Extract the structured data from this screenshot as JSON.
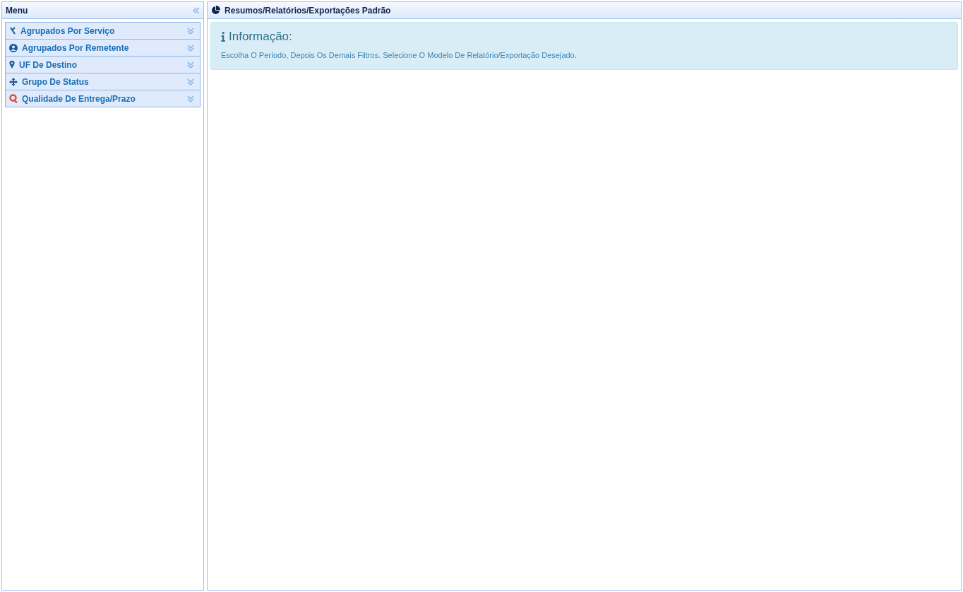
{
  "sidebar": {
    "title": "Menu",
    "items": [
      {
        "label": "Agrupados Por Serviço",
        "expanded": false
      },
      {
        "label": "Agrupados Por Remetente",
        "expanded": false
      },
      {
        "label": "UF De Destino",
        "expanded": false
      },
      {
        "label": "Grupo De Status",
        "expanded": false
      },
      {
        "label": "Qualidade De Entrega/Prazo",
        "expanded": false
      }
    ]
  },
  "main": {
    "title": "Resumos/Relatórios/Exportações Padrão",
    "info": {
      "heading": "Informação:",
      "text": "Escolha O Período, Depois Os Demais Filtros. Selecione O Modelo De Relatório/Exportação Desejado."
    }
  }
}
